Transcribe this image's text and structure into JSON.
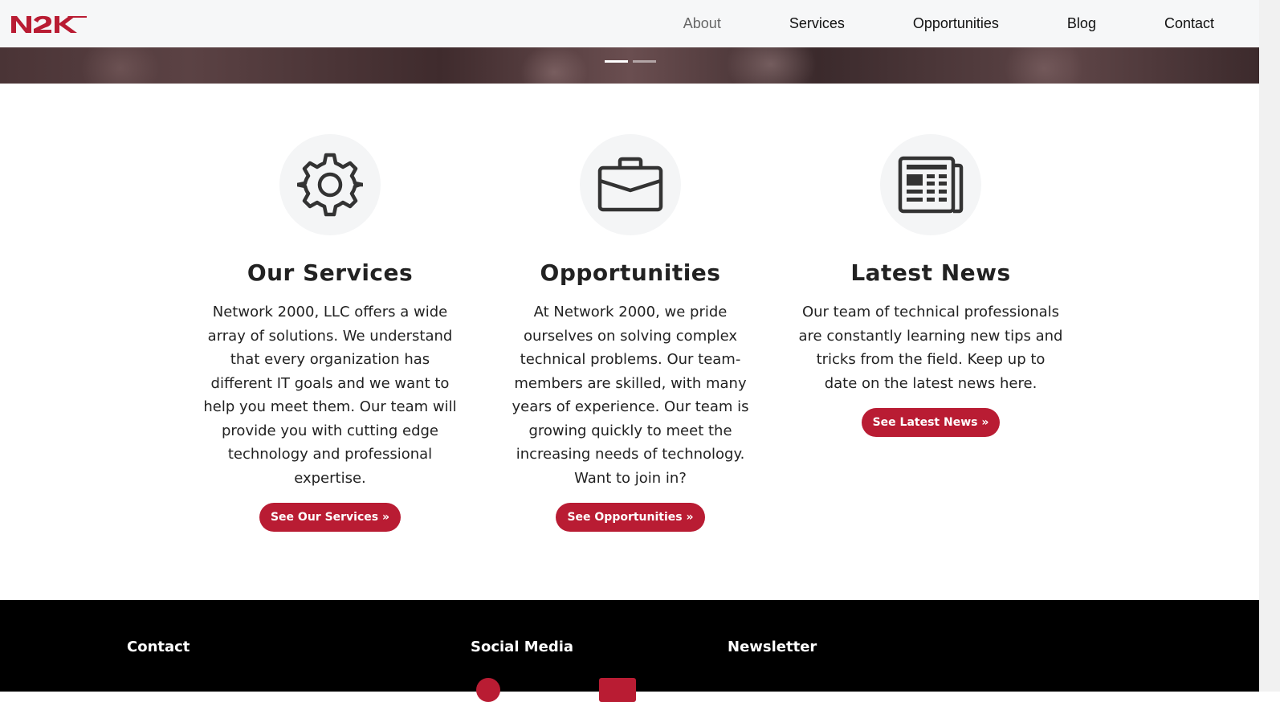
{
  "brand": {
    "logo_text": "N2K",
    "accent_color": "#b91c33"
  },
  "nav": {
    "items": [
      {
        "label": "About",
        "active": true
      },
      {
        "label": "Services",
        "active": false
      },
      {
        "label": "Opportunities",
        "active": false
      },
      {
        "label": "Blog",
        "active": false
      },
      {
        "label": "Contact",
        "active": false
      }
    ]
  },
  "carousel": {
    "slide_count": 2,
    "active_index": 0
  },
  "features": [
    {
      "icon": "gear-icon",
      "title": "Our Services",
      "text": "Network 2000, LLC offers a wide array of solutions. We understand that every organization has different IT goals and we want to help you meet them. Our team will provide you with cutting edge technology and professional expertise.",
      "button": "See Our Services »"
    },
    {
      "icon": "briefcase-icon",
      "title": "Opportunities",
      "text": "At Network 2000, we pride ourselves on solving complex technical problems. Our team-members are skilled, with many years of experience. Our team is growing quickly to meet the increasing needs of technology. Want to join in?",
      "button": "See Opportunities »"
    },
    {
      "icon": "newspaper-icon",
      "title": "Latest News",
      "text": "Our team of technical professionals are constantly learning new tips and tricks from the field. Keep up to date on the latest news here.",
      "button": "See Latest News »"
    }
  ],
  "footer": {
    "contact_heading": "Contact",
    "social_heading": "Social Media",
    "newsletter_heading": "Newsletter"
  }
}
